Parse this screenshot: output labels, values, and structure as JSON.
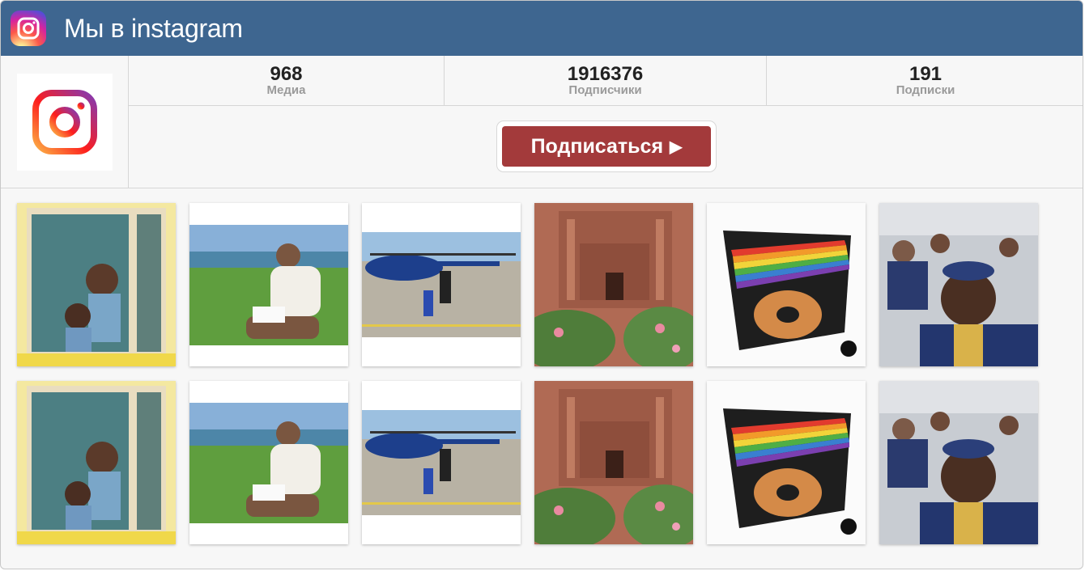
{
  "header": {
    "title": "Мы в instagram",
    "icon": "instagram-icon"
  },
  "profile": {
    "avatar_icon": "instagram-logo"
  },
  "stats": [
    {
      "value": "968",
      "label": "Медиа"
    },
    {
      "value": "1916376",
      "label": "Подписчики"
    },
    {
      "value": "191",
      "label": "Подписки"
    }
  ],
  "follow_button": {
    "label": "Подписаться",
    "arrow": "▶"
  },
  "colors": {
    "header": "#3e6690",
    "button": "#a33a3b"
  },
  "photos": [
    "kids-in-train-window",
    "man-sitting-on-grass",
    "helicopter-on-pad",
    "petra-monastery",
    "rainbow-record-box",
    "selfie-in-crowd",
    "kids-in-train-window",
    "man-sitting-on-grass",
    "helicopter-on-pad",
    "petra-monastery",
    "rainbow-record-box",
    "selfie-in-crowd"
  ]
}
